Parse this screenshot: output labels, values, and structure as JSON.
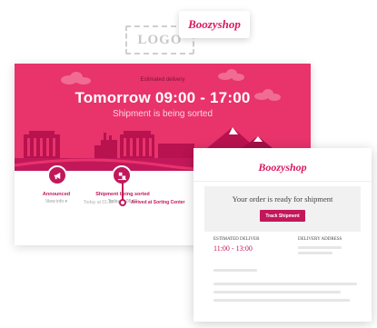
{
  "logo_placeholder": "LOGO",
  "brand": "Boozyshop",
  "tracking": {
    "label": "Estimated delivery",
    "time_window": "Tomorrow 09:00 - 17:00",
    "status": "Shipment is being sorted",
    "steps": [
      {
        "title": "Announced",
        "sub": "View info ▾",
        "icon": "megaphone-icon"
      },
      {
        "title": "Shipment being sorted",
        "sub": "Today in 08:45",
        "icon": "sorting-icon"
      }
    ],
    "timeline": {
      "time": "Today at 01:30",
      "event": "Arrived at Sorting Center"
    }
  },
  "email": {
    "brand": "Boozyshop",
    "ready_text": "Your order is ready for shipment",
    "button": "Track Shipment",
    "estimated_label": "ESTIMATED DELIVER",
    "estimated_value": "11:00 - 13:00",
    "address_label": "DELIVERY ADDRESS"
  },
  "colors": {
    "accent": "#e8336b",
    "accent_dark": "#c2185b"
  }
}
